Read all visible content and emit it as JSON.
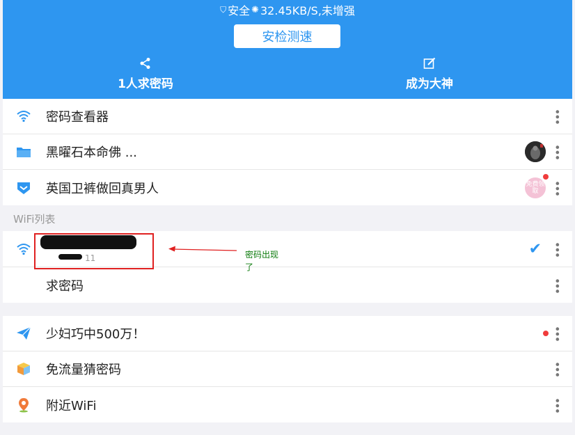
{
  "header": {
    "status": {
      "prefix": "安全",
      "speed": "32.45KB/S,未增强"
    },
    "speed_button": "安检测速",
    "actions": [
      {
        "icon": "share-icon",
        "label": "1人求密码"
      },
      {
        "icon": "edit-icon",
        "label": "成为大神"
      }
    ],
    "colors": {
      "primary": "#2e96f0"
    }
  },
  "top_menu": [
    {
      "icon": "wifi-icon",
      "label": "密码查看器"
    },
    {
      "icon": "folder-icon",
      "label": "黑曜石本命佛 ..."
    },
    {
      "icon": "shield-check-icon",
      "label": "英国卫裤做回真男人",
      "badge_text": "免费领取"
    }
  ],
  "wifi_list": {
    "title": "WiFi列表",
    "connected": {
      "name_redacted": true,
      "sub_visible": "11"
    },
    "request_password": "求密码"
  },
  "bottom_menu": [
    {
      "icon": "paper-plane-icon",
      "label": "少妇巧中500万！"
    },
    {
      "icon": "cube-icon",
      "label": "免流量猜密码"
    },
    {
      "icon": "location-pin-icon",
      "label": "附近WiFi"
    }
  ],
  "annotation": {
    "text_line1": "密码出现",
    "text_line2": "了"
  }
}
